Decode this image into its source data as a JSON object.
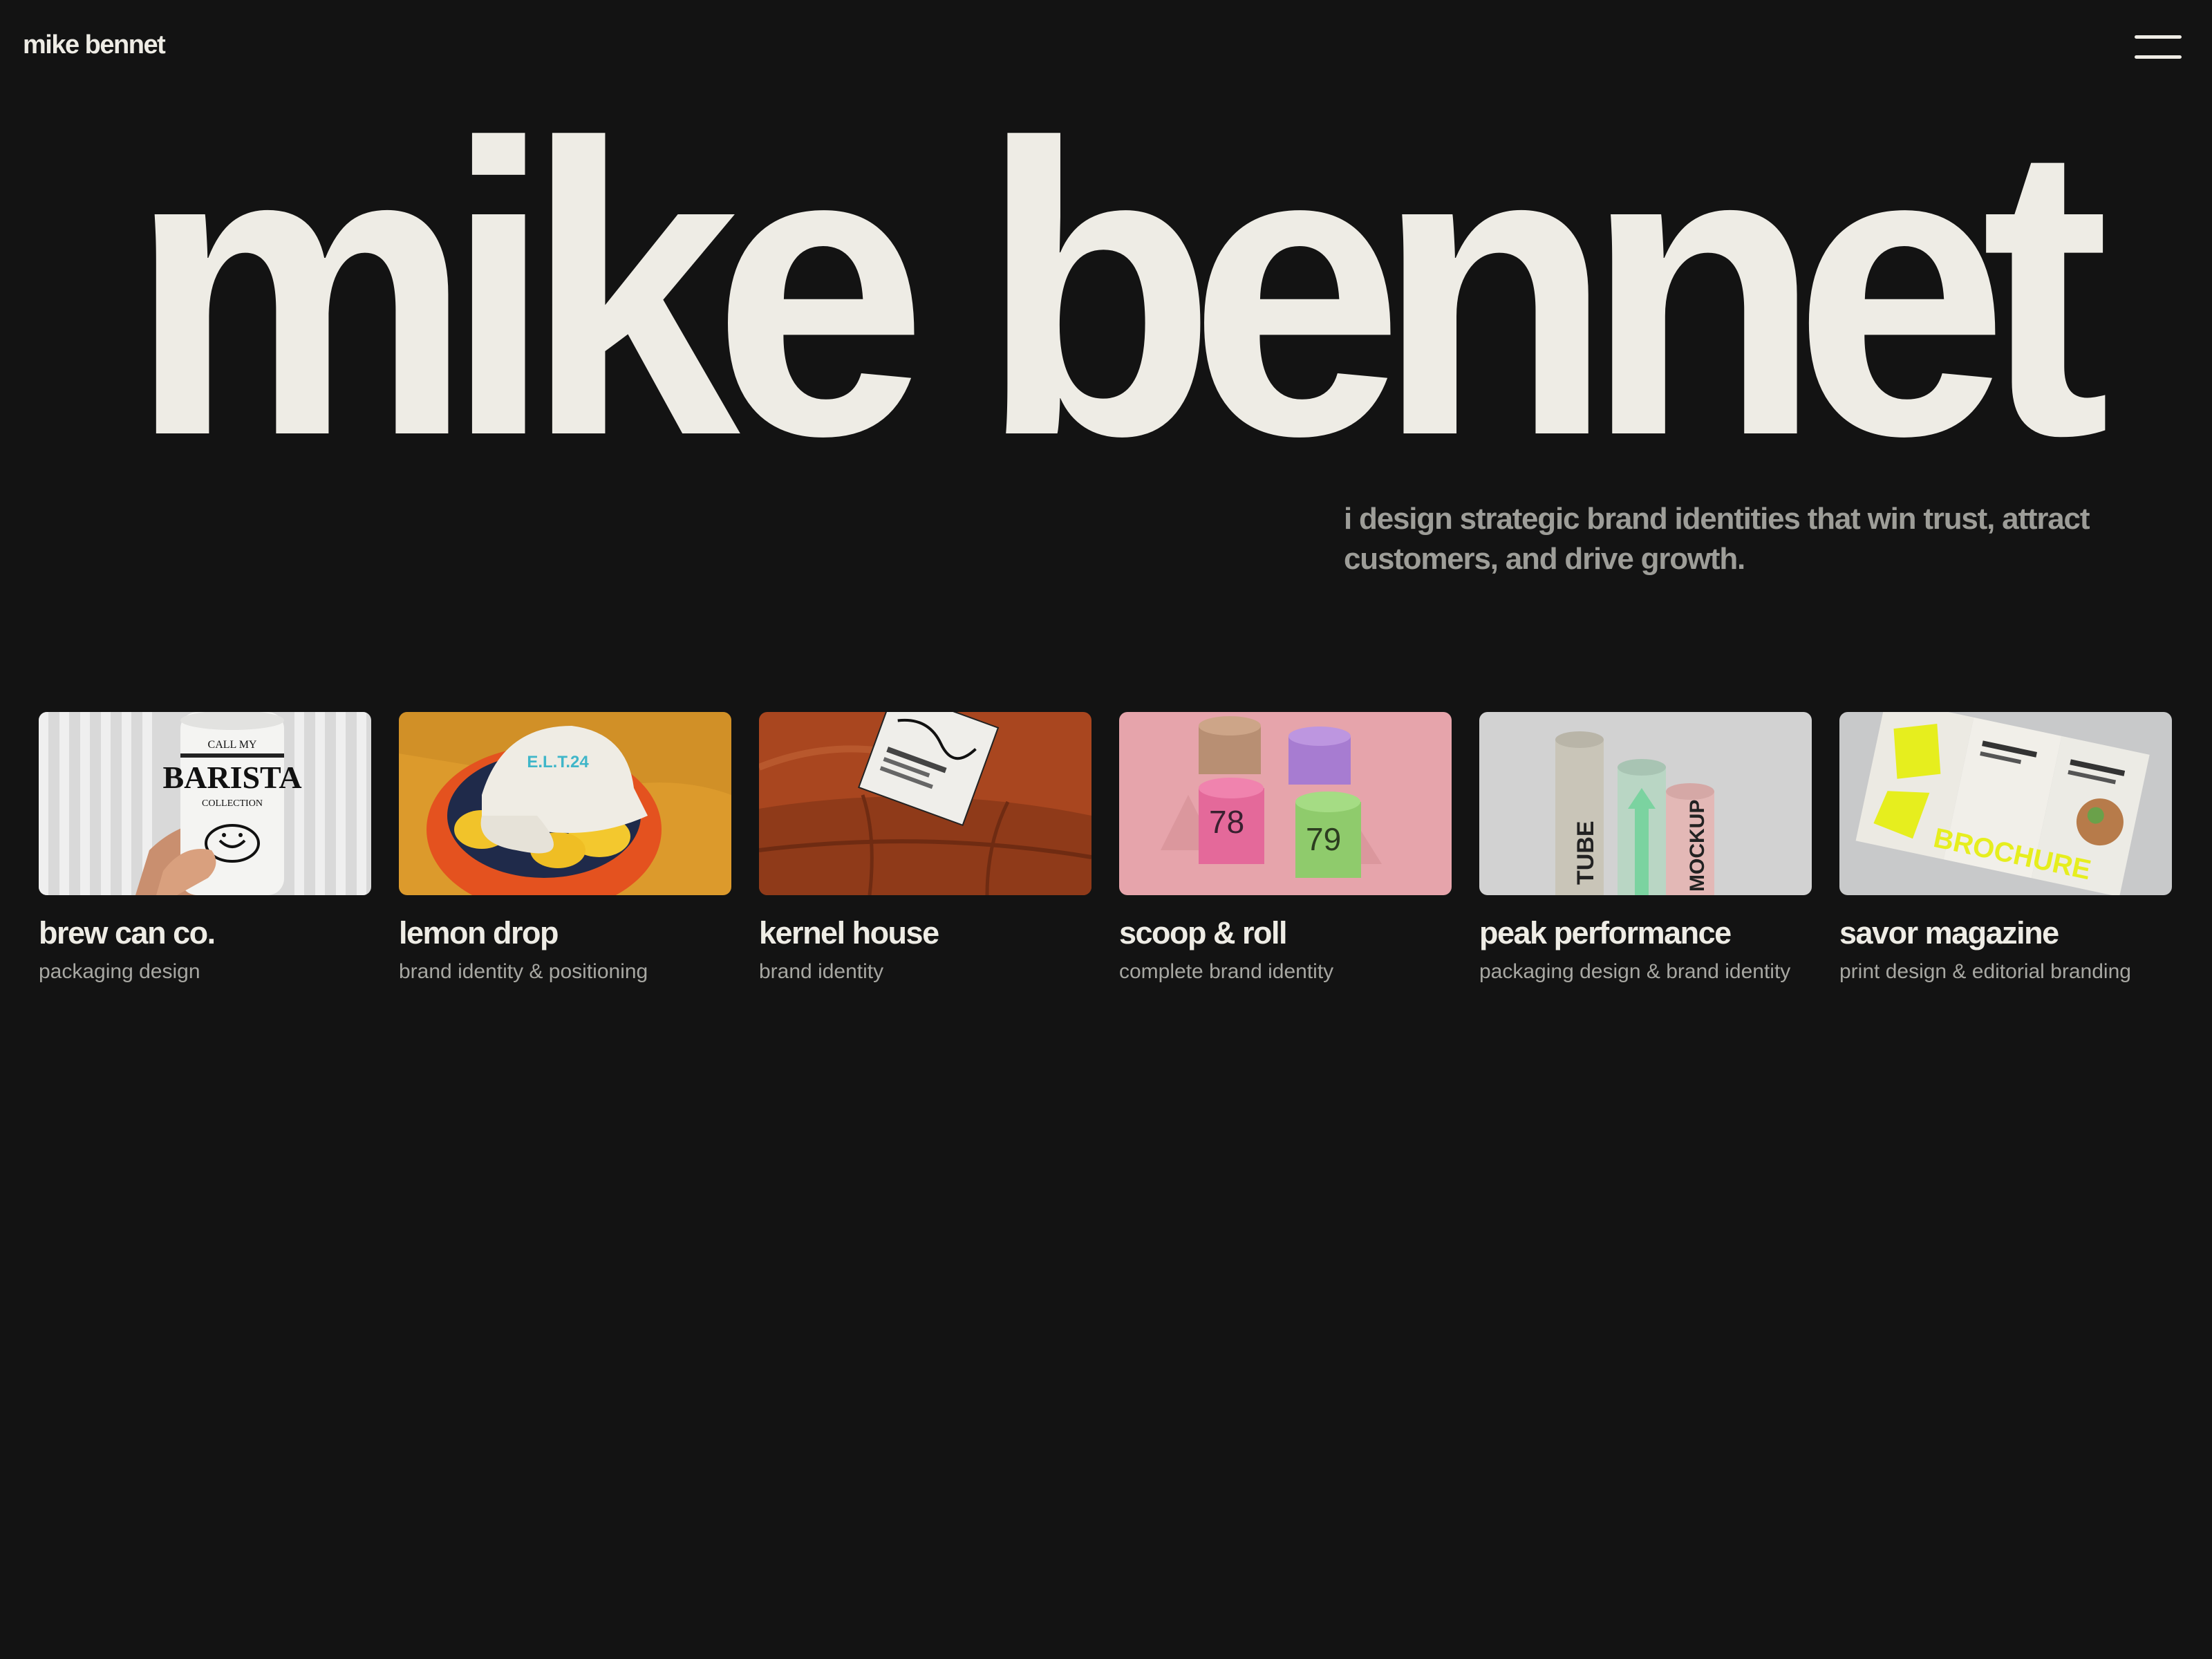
{
  "header": {
    "logo": "mike bennet",
    "menu_icon": "hamburger-menu-icon"
  },
  "hero": {
    "title": "mike bennet",
    "tagline": "i design strategic brand identities that win trust, attract customers, and drive growth."
  },
  "projects": [
    {
      "title": "brew can co.",
      "subtitle": "packaging design",
      "image": "beverage-can-photo",
      "image_text": [
        "CALL MY",
        "BARISTA",
        "COLLECTION"
      ],
      "bg": "#dcdcdc"
    },
    {
      "title": "lemon drop",
      "subtitle": "brand identity & positioning",
      "image": "cap-and-lemons-photo",
      "image_text": [
        "E.L.T.24"
      ],
      "bg": "#e1a233"
    },
    {
      "title": "kernel house",
      "subtitle": "brand identity",
      "image": "book-on-leather-photo",
      "image_text": [],
      "bg": "#b4532a"
    },
    {
      "title": "scoop & roll",
      "subtitle": "complete brand identity",
      "image": "ice-cream-cups-photo",
      "image_text": [
        "78",
        "79"
      ],
      "bg": "#e5a6ad"
    },
    {
      "title": "peak performance",
      "subtitle": "packaging design & brand identity",
      "image": "tube-packaging-photo",
      "image_text": [
        "TUBE",
        "MOCKUP"
      ],
      "bg": "#d4d4d4"
    },
    {
      "title": "savor magazine",
      "subtitle": "print design & editorial branding",
      "image": "brochure-photo",
      "image_text": [
        "BROCHURE"
      ],
      "bg": "#c9cacb"
    }
  ]
}
